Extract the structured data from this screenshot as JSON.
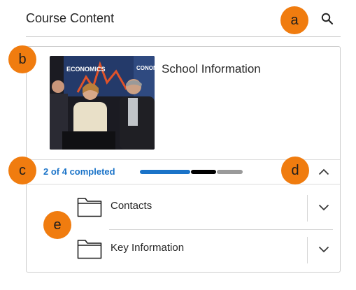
{
  "header": {
    "title": "Course Content"
  },
  "course": {
    "title": "School Information",
    "image_banner_text": "ECONOMICS",
    "image_banner_text_2": "CONOMI"
  },
  "progress": {
    "text": "2 of 4 completed",
    "completed": 2,
    "total": 4,
    "segment_colors": [
      "#1a73c8",
      "#000000",
      "#9a9a9a"
    ]
  },
  "folders": [
    {
      "label": "Contacts"
    },
    {
      "label": "Key Information"
    }
  ],
  "markers": {
    "a": "a",
    "b": "b",
    "c": "c",
    "d": "d",
    "e": "e"
  },
  "colors": {
    "accent": "#1a73c8",
    "marker": "#f07c0f"
  }
}
